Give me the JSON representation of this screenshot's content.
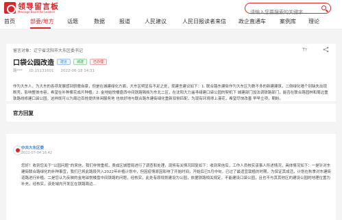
{
  "brand": {
    "name_cn": "领导留言板",
    "name_en": "Message Board for Leaders",
    "accent": "#d8262b"
  },
  "search": {
    "placeholder": "请输入您要搜索的关键字"
  },
  "nav": {
    "items": [
      "首页",
      "部委/地方",
      "话题",
      "数据",
      "报道",
      "人民建议",
      "人民日报读者来信",
      "政企直通车",
      "案例库",
      "理论"
    ],
    "active_index": 1
  },
  "message": {
    "target_label": "留言对象：",
    "target_value": "辽宁省沈阳市大东区委书记",
    "title": "口袋公园改造",
    "tags": [
      "建言",
      "城建",
      "已办理"
    ],
    "author": "路***",
    "id": "ID:15131601",
    "time": "2022-06-18 14:31",
    "body": "作为大东人，为大东的各项发展感到骄傲自豪，但是在城建绿化方面，大东区明显有不足之处，现建言建议如下：1. 联合路东建街作为大东区为数不多的新建建筑，二侧绿化墙个别缺失出现断壳，影响整体市容，希望在补种紫花成片种植。2. 金地始悦楼盘西中间铁路隔挡为东北二区，在沈阳大力遥寻绿建口袋公园的契机下 城建部门加法调铁路部门，能否在联合路园林和周边重铁路线修建口袋公园，这样既可以为周边百姓提供休闲服务地 也依好地与联合路东建街绿化重新双侧匹配，为现有环境得上港花，希望尽快改善 早早立项，期盼。"
  },
  "reply": {
    "section_title": "官方回复",
    "org_name": "中共大东区委",
    "date": "2022-07-04 16:42",
    "body": "您好！收到您关于“公园问题”的来信，我们非常重视，责成区城管局进行了调查和处理，现将有关情况回复如下：收到来信后，工作人员核实该事人所述情况，具体情况如下：一是针对东建街联合路绿化的补种事宜，我们已将此路段列入2022年补植计划中，但因疫情原因影响了开始时间，开始后已5月中旬，已过了最适宜栽植的时期，为保证其成活，计划在秋季对东建街道路进行补植。二是您认为反映的金地铂悦楼盘中间铁路的问题，经核实，此处有原规划建设为公园，依据铁路相关规定，不能建设口袋公园，且也不与其其他区的建设公园的地理位置为补充，经核实，该处域内开发区在铁路周边..."
  }
}
